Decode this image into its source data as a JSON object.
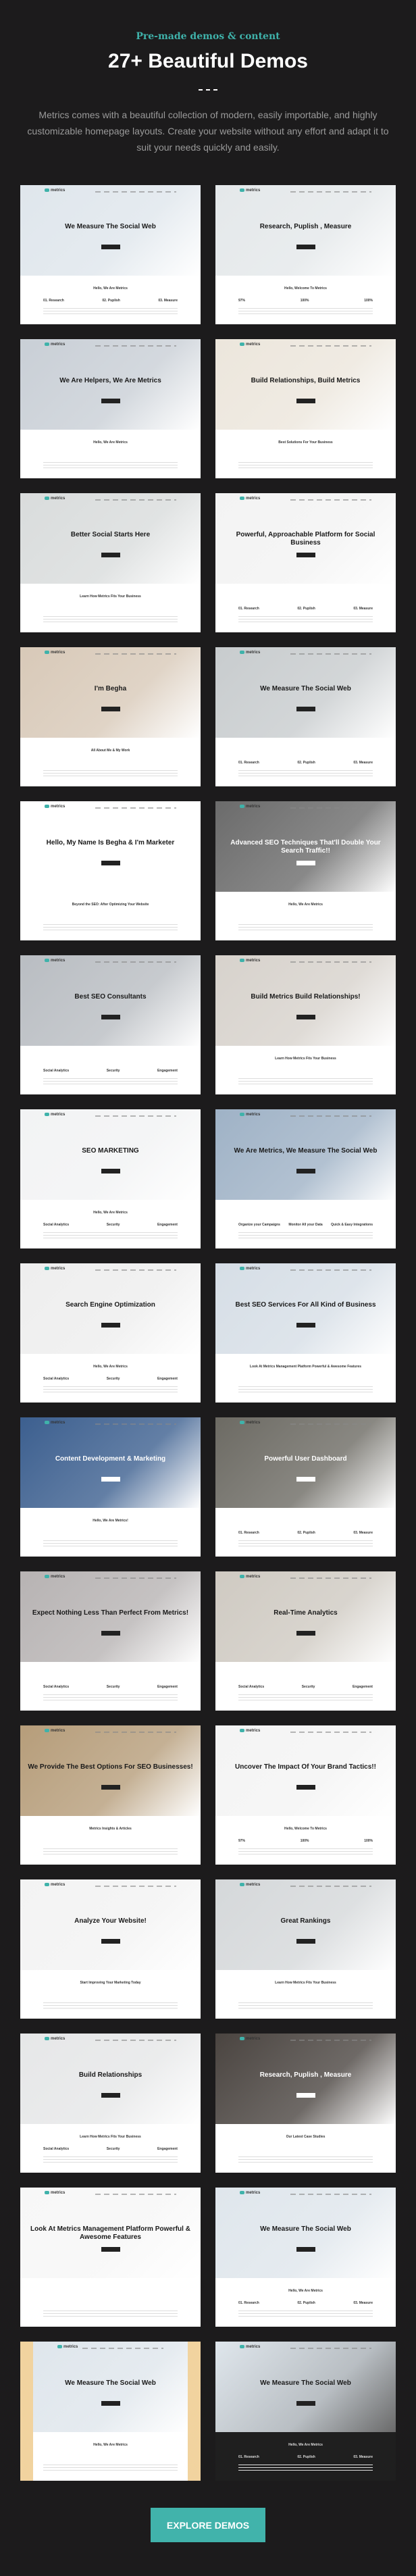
{
  "header": {
    "eyebrow": "Pre-made demos & content",
    "title": "27+ Beautiful Demos",
    "intro": "Metrics comes with a beautiful collection of modern, easily importable, and highly customizable homepage layouts. Create your website without any effort and adapt it to suit your needs quickly and easily."
  },
  "logo": "metrics",
  "colors": {
    "accent": "#41b3ab",
    "background": "#1c1b1c"
  },
  "demos": [
    {
      "hero": "We Measure The Social Web",
      "section": "Hello, We Are Metrics",
      "cols": [
        "01. Research",
        "02. Puplish",
        "03. Measure"
      ],
      "hero_color": "#dfe6ec",
      "text": "dark"
    },
    {
      "hero": "Research, Puplish , Measure",
      "section": "Hello, Welcome To Metrics",
      "cols": [
        "97%",
        "100%",
        "100%"
      ],
      "hero_color": "#e4e8ea",
      "text": "dark"
    },
    {
      "hero": "We Are Helpers, We Are Metrics",
      "section": "Hello, We Are Metrics",
      "cols": [],
      "hero_color": "#c9cfd6",
      "text": "dark"
    },
    {
      "hero": "Build Relationships, Build Metrics",
      "section": "Best Solutions For Your Business",
      "cols": [],
      "hero_color": "#ece6dc",
      "text": "dark"
    },
    {
      "hero": "Better Social Starts Here",
      "section": "Learn How Metrics Fits Your Business",
      "cols": [],
      "hero_color": "#d9dcdc",
      "text": "dark"
    },
    {
      "hero": "Powerful, Approachable Platform for Social Business",
      "section": "",
      "cols": [
        "01. Research",
        "02. Puplish",
        "03. Measure"
      ],
      "hero_color": "#f3f3f3",
      "text": "dark"
    },
    {
      "hero": "I'm Begha",
      "section": "All About Me & My Work",
      "cols": [],
      "hero_color": "#d8c9b8",
      "text": "dark"
    },
    {
      "hero": "We Measure The Social Web",
      "section": "",
      "cols": [
        "01. Research",
        "02. Puplish",
        "03. Measure"
      ],
      "hero_color": "#c8ccce",
      "text": "dark"
    },
    {
      "hero": "Hello, My Name Is Begha & I'm Marketer",
      "section": "Beyond the SEO: After Optimizing Your Website",
      "cols": [],
      "hero_color": "#ffffff",
      "text": "dark"
    },
    {
      "hero": "Advanced SEO Techniques That'll Double Your Search Traffic!!",
      "section": "Hello, We Are Metrics",
      "cols": [],
      "hero_color": "#6b6b6b",
      "text": "light"
    },
    {
      "hero": "Best SEO Consultants",
      "section": "",
      "cols": [
        "Social Analytics",
        "Security",
        "Engagement"
      ],
      "hero_color": "#b9bdc2",
      "text": "dark"
    },
    {
      "hero": "Build Metrics Build Relationships!",
      "section": "Learn How Metrics Fits Your Business",
      "cols": [],
      "hero_color": "#d7d2cc",
      "text": "dark"
    },
    {
      "hero": "SEO MARKETING",
      "section": "Hello, We Are Metrics",
      "cols": [
        "Social Analytics",
        "Security",
        "Engagement"
      ],
      "hero_color": "#f2f3f4",
      "text": "dark"
    },
    {
      "hero": "We Are Metrics, We Measure The Social Web",
      "section": "",
      "cols": [
        "Organize your Campaigns",
        "Monitor All your Data",
        "Quick & Easy Integrations"
      ],
      "hero_color": "#9fb2c6",
      "text": "dark"
    },
    {
      "hero": "Search Engine Optimization",
      "section": "Hello, We Are Metrics",
      "cols": [
        "Social Analytics",
        "Security",
        "Engagement"
      ],
      "hero_color": "#eeeeee",
      "text": "dark"
    },
    {
      "hero": "Best SEO Services For All Kind of Business",
      "section": "Look At Metrics Management Platform Powerful & Awesome Features",
      "cols": [],
      "hero_color": "#d6dee6",
      "text": "dark"
    },
    {
      "hero": "Content Development & Marketing",
      "section": "Hello, We Are Metrics!",
      "cols": [],
      "hero_color": "#3c5f8f",
      "text": "light"
    },
    {
      "hero": "Powerful User Dashboard",
      "section": "",
      "cols": [
        "01. Research",
        "02. Puplish",
        "03. Measure"
      ],
      "hero_color": "#6c6a63",
      "text": "light"
    },
    {
      "hero": "Expect Nothing Less Than Perfect From Metrics!",
      "section": "",
      "cols": [
        "Social Analytics",
        "Security",
        "Engagement"
      ],
      "hero_color": "#b7b3b3",
      "text": "dark"
    },
    {
      "hero": "Real-Time Analytics",
      "section": "",
      "cols": [
        "Social Analytics",
        "Security",
        "Engagement"
      ],
      "hero_color": "#cfcac2",
      "text": "dark"
    },
    {
      "hero": "We Provide The Best Options For SEO Businesses!",
      "section": "Metrics Insights & Articles",
      "cols": [],
      "hero_color": "#b69d7a",
      "text": "dark"
    },
    {
      "hero": "Uncover The Impact Of Your Brand Tactics!!",
      "section": "Hello, Welcome To Metrics",
      "cols": [
        "97%",
        "100%",
        "100%"
      ],
      "hero_color": "#f4f4f4",
      "text": "dark"
    },
    {
      "hero": "Analyze Your Website!",
      "section": "Start Improving Your Marketing Today",
      "cols": [],
      "hero_color": "#f3f3f3",
      "text": "dark"
    },
    {
      "hero": "Great Rankings",
      "section": "Learn How Metrics Fits Your Business",
      "cols": [],
      "hero_color": "#d5d8da",
      "text": "dark"
    },
    {
      "hero": "Build Relationships",
      "section": "Learn How Metrics Fits Your Business",
      "cols": [
        "Social Analytics",
        "Security",
        "Engagement"
      ],
      "hero_color": "#e6e7e8",
      "text": "dark"
    },
    {
      "hero": "Research, Puplish , Measure",
      "section": "Our Latest Case Studies",
      "cols": [],
      "hero_color": "#4a4440",
      "text": "light"
    },
    {
      "hero": "Look At Metrics Management Platform Powerful & Awesome Features",
      "section": "",
      "cols": [],
      "hero_color": "#f7f7f7",
      "text": "dark"
    },
    {
      "hero": "We Measure The Social Web",
      "section": "Hello, We Are Metrics",
      "cols": [
        "01. Research",
        "02. Puplish",
        "03. Measure"
      ],
      "hero_color": "#dfe6ec",
      "text": "dark"
    },
    {
      "hero": "We Measure The Social Web",
      "section": "Hello, We Are Metrics",
      "cols": [],
      "hero_color": "#dfe6ec",
      "text": "dark",
      "frame_color": "#f1d39f"
    },
    {
      "hero": "We Measure The Social Web",
      "section": "Hello, We Are Metrics",
      "cols": [
        "01. Research",
        "02. Puplish",
        "03. Measure"
      ],
      "hero_color": "#dfe6ec",
      "text": "dark",
      "lower_color": "#1f1f1f"
    }
  ],
  "cta": {
    "label": "EXPLORE DEMOS"
  }
}
